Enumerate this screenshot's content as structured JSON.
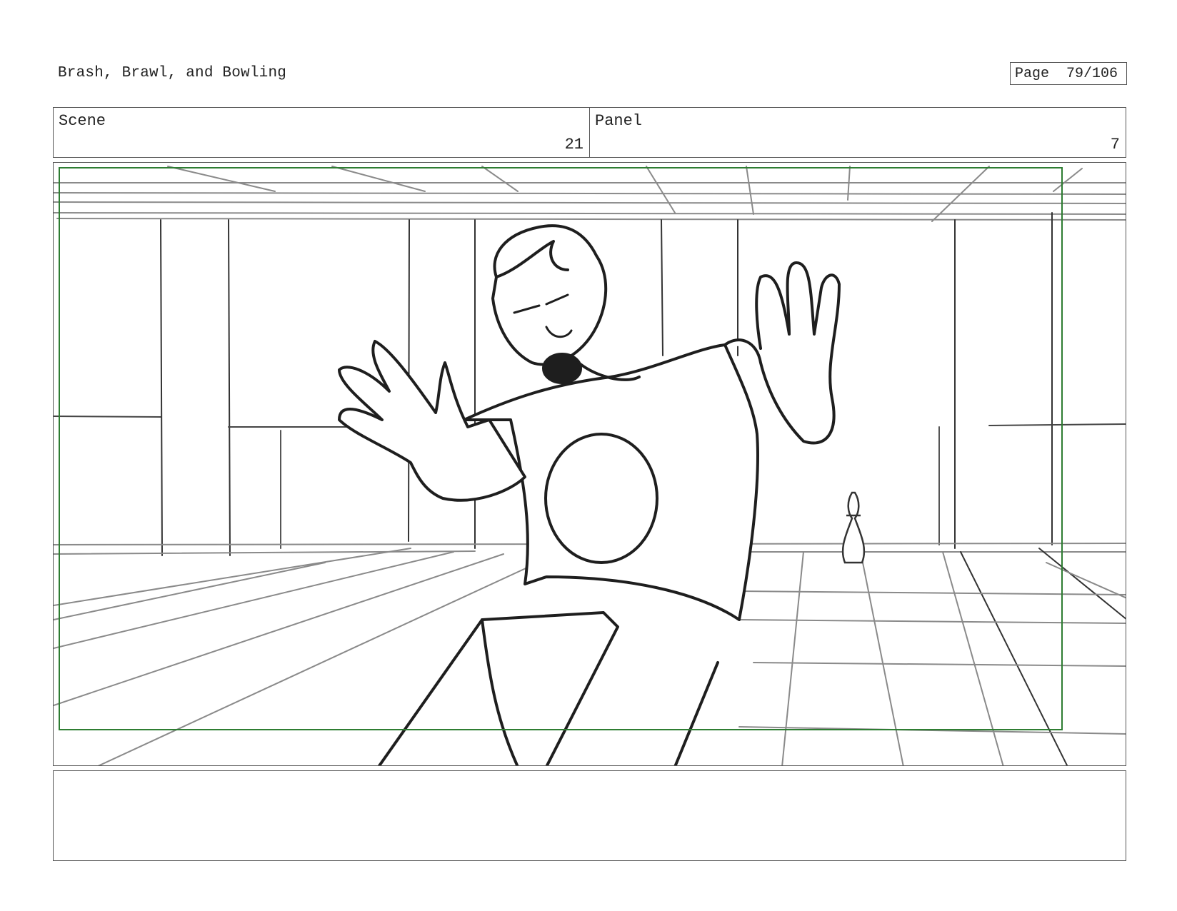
{
  "header": {
    "project_title": "Brash, Brawl, and Bowling",
    "page_label": "Page",
    "page_number": "79/106"
  },
  "info": {
    "scene_label": "Scene",
    "scene_value": "21",
    "panel_label": "Panel",
    "panel_value": "7"
  },
  "panel": {
    "safe_frame_color": "#2e7d32",
    "sketch_color": "#1e1e1e",
    "background_line_color": "#8a8a8a"
  },
  "notes": {
    "text": ""
  }
}
